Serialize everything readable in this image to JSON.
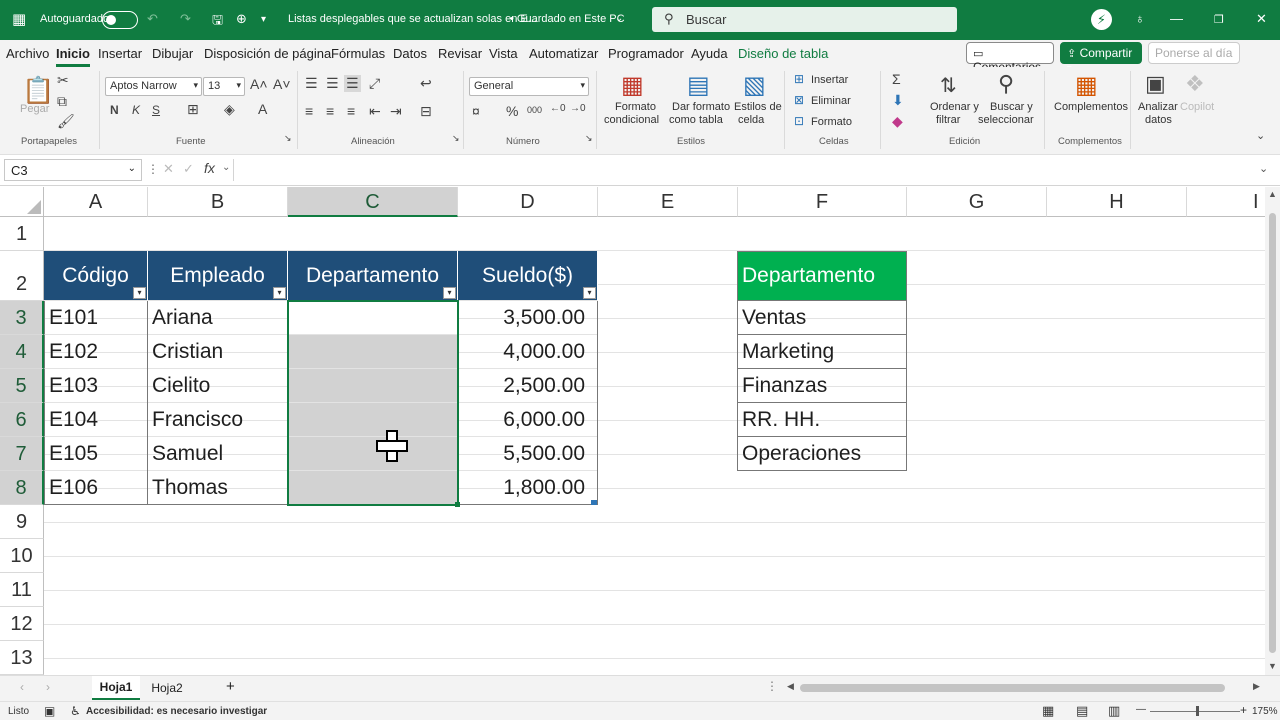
{
  "titlebar": {
    "autosave_label": "Autoguardado",
    "doc_title": "Listas desplegables que se actualizan solas en E...",
    "save_status": "• Guardado en Este PC",
    "search_placeholder": "Buscar"
  },
  "menu": {
    "tabs": [
      "Archivo",
      "Inicio",
      "Insertar",
      "Dibujar",
      "Disposición de página",
      "Fórmulas",
      "Datos",
      "Revisar",
      "Vista",
      "Automatizar",
      "Programador",
      "Ayuda",
      "Diseño de tabla"
    ],
    "comments": "Comentarios",
    "share": "Compartir",
    "catchup": "Ponerse al día"
  },
  "ribbon": {
    "paste": "Pegar",
    "font_name": "Aptos Narrow",
    "font_size": "13",
    "number_format": "General",
    "cond_format": [
      "Formato",
      "condicional"
    ],
    "table_format": [
      "Dar formato",
      "como tabla"
    ],
    "cell_styles": [
      "Estilos de",
      "celda"
    ],
    "insert": "Insertar",
    "delete": "Eliminar",
    "format": "Formato",
    "sort": [
      "Ordenar y",
      "filtrar"
    ],
    "find": [
      "Buscar y",
      "seleccionar"
    ],
    "addins": "Complementos",
    "analyze": [
      "Analizar",
      "datos"
    ],
    "copilot": "Copilot",
    "groups": {
      "clipboard": "Portapapeles",
      "font": "Fuente",
      "alignment": "Alineación",
      "number": "Número",
      "styles": "Estilos",
      "cells": "Celdas",
      "editing": "Edición",
      "addins": "Complementos"
    }
  },
  "formula_bar": {
    "name_box": "C3",
    "formula": ""
  },
  "columns": [
    "A",
    "B",
    "C",
    "D",
    "E",
    "F",
    "G",
    "H",
    "I"
  ],
  "rows": [
    "1",
    "2",
    "3",
    "4",
    "5",
    "6",
    "7",
    "8",
    "9",
    "10",
    "11",
    "12",
    "13"
  ],
  "table": {
    "headers": [
      "Código",
      "Empleado",
      "Departamento",
      "Sueldo($)"
    ],
    "rows": [
      [
        "E101",
        "Ariana",
        "",
        "3,500.00"
      ],
      [
        "E102",
        "Cristian",
        "",
        "4,000.00"
      ],
      [
        "E103",
        "Cielito",
        "",
        "2,500.00"
      ],
      [
        "E104",
        "Francisco",
        "",
        "6,000.00"
      ],
      [
        "E105",
        "Samuel",
        "",
        "5,500.00"
      ],
      [
        "E106",
        "Thomas",
        "",
        "1,800.00"
      ]
    ]
  },
  "dept_list": {
    "header": "Departamento",
    "items": [
      "Ventas",
      "Marketing",
      "Finanzas",
      "RR. HH.",
      "Operaciones"
    ]
  },
  "sheets": [
    "Hoja1",
    "Hoja2"
  ],
  "status": {
    "ready": "Listo",
    "accessibility": "Accesibilidad: es necesario investigar",
    "zoom": "175%"
  },
  "colors": {
    "excel_green": "#107c41",
    "table_header": "#1f4e79",
    "list_header": "#00b050",
    "selection": "#d2d2d2"
  }
}
